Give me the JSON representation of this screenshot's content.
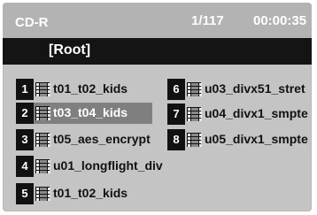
{
  "header": {
    "disc_type": "CD-R",
    "counter": "1/117",
    "time": "00:00:35"
  },
  "path": "[Root]",
  "files": [
    {
      "num": "1",
      "name": "t01_t02_kids"
    },
    {
      "num": "2",
      "name": "t03_t04_kids",
      "selected": true
    },
    {
      "num": "3",
      "name": "t05_aes_encrypt"
    },
    {
      "num": "4",
      "name": "u01_longflight_div"
    },
    {
      "num": "5",
      "name": "t01_t02_kids"
    },
    {
      "num": "6",
      "name": "u03_divx51_stret"
    },
    {
      "num": "7",
      "name": "u04_divx1_smpte"
    },
    {
      "num": "8",
      "name": "u05_divx1_smpte"
    }
  ],
  "icon": "video-file-icon",
  "colors": {
    "background": "#c4c4c4",
    "title_bar": "#b3b3b3",
    "path_bar": "#141414",
    "selection": "#7f7f7f"
  }
}
